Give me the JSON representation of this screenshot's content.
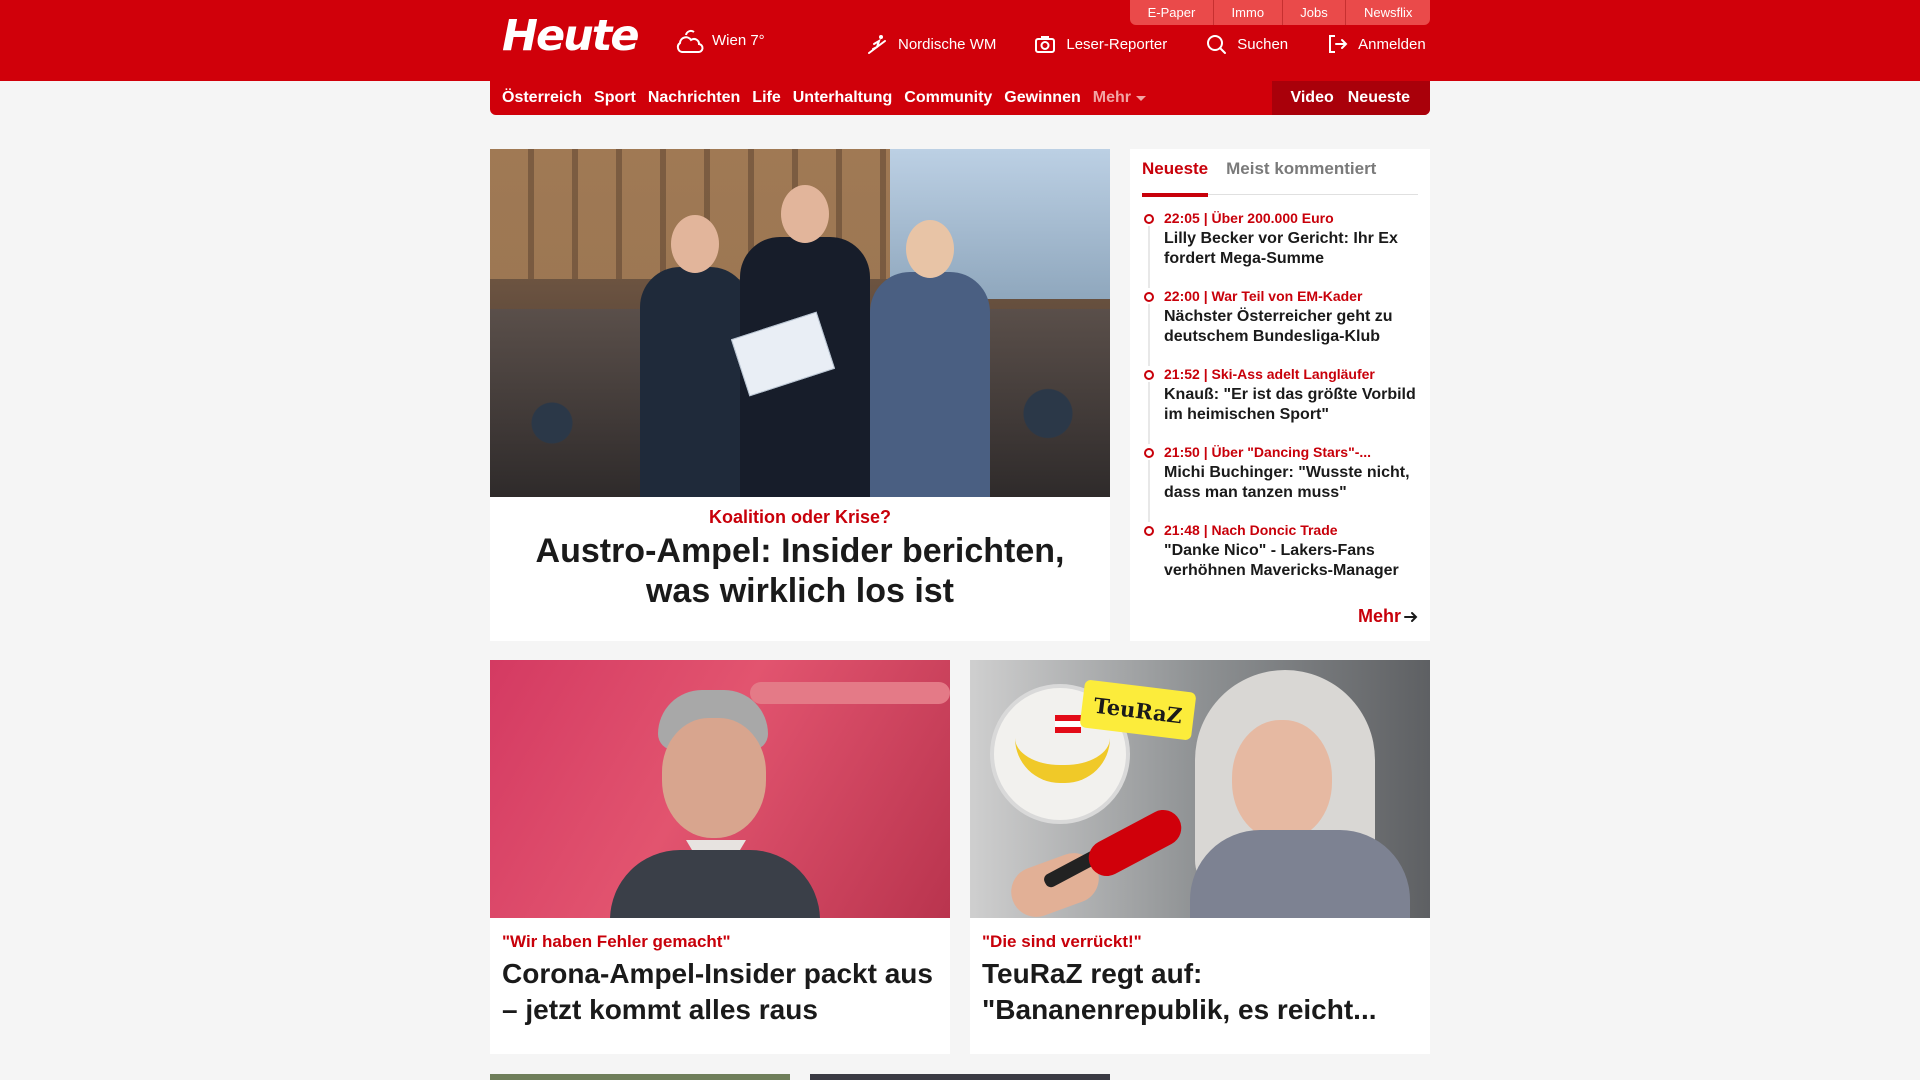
{
  "brand": {
    "logo_text": "Heute",
    "accent": "#d0000a"
  },
  "weather": {
    "icon": "cloud-sun-icon",
    "label": "Wien 7°"
  },
  "top_links": [
    "E-Paper",
    "Immo",
    "Jobs",
    "Newsflix"
  ],
  "header_actions": [
    {
      "icon": "skier-icon",
      "label": "Nordische WM"
    },
    {
      "icon": "camera-icon",
      "label": "Leser-Reporter"
    },
    {
      "icon": "search-icon",
      "label": "Suchen"
    },
    {
      "icon": "login-icon",
      "label": "Anmelden"
    }
  ],
  "nav": {
    "items": [
      "Österreich",
      "Sport",
      "Nachrichten",
      "Life",
      "Unterhaltung",
      "Community",
      "Gewinnen"
    ],
    "more_label": "Mehr",
    "right_items": [
      "Video",
      "Neueste"
    ]
  },
  "hero": {
    "kicker": "Koalition oder Krise?",
    "title": "Austro-Ampel: Insider berichten, was wirklich los ist"
  },
  "sidebar": {
    "tabs": [
      "Neueste",
      "Meist kommentiert"
    ],
    "active_tab": 0,
    "items": [
      {
        "meta": "22:05 | Über 200.000 Euro",
        "title": "Lilly Becker vor Gericht: Ihr Ex fordert Mega-Summe"
      },
      {
        "meta": "22:00 | War Teil von EM-Kader",
        "title": "Nächster Österreicher geht zu deutschem Bundesliga-Klub"
      },
      {
        "meta": "21:52 | Ski-Ass adelt Langläufer",
        "title": "Knauß: \"Er ist das größte Vorbild im heimischen Sport\""
      },
      {
        "meta": "21:50 | Über \"Dancing Stars\"-...",
        "title": "Michi Buchinger: \"Wusste nicht, dass man tanzen muss\""
      },
      {
        "meta": "21:48 | Nach Doncic Trade",
        "title": "\"Danke Nico\" - Lakers-Fans verhöhnen Mavericks-Manager"
      }
    ],
    "more_label": "Mehr"
  },
  "cards": [
    {
      "kicker": "\"Wir haben Fehler gemacht\"",
      "title": "Corona-Ampel-Insider packt aus – jetzt kommt alles raus"
    },
    {
      "kicker": "\"Die sind verrückt!\"",
      "title": "TeuRaZ regt auf: \"Bananenrepublik, es reicht...",
      "badge": "TeuRaZ"
    }
  ]
}
